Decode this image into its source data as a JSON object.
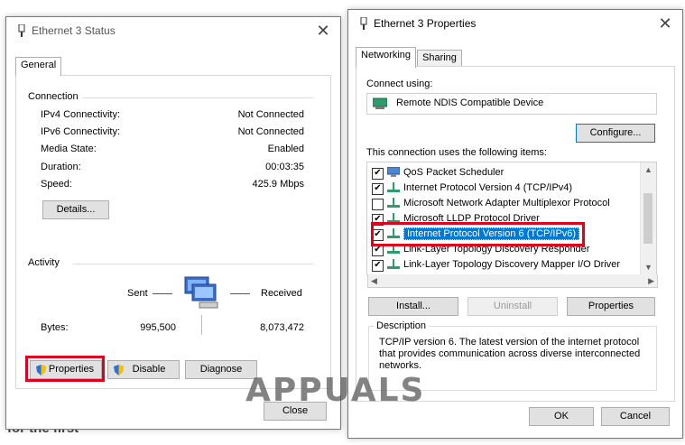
{
  "left_window": {
    "title": "Ethernet 3 Status",
    "tab": "General",
    "connection": {
      "heading": "Connection",
      "rows": [
        {
          "label": "IPv4 Connectivity:",
          "value": "Not Connected"
        },
        {
          "label": "IPv6 Connectivity:",
          "value": "Not Connected"
        },
        {
          "label": "Media State:",
          "value": "Enabled"
        },
        {
          "label": "Duration:",
          "value": "00:03:35"
        },
        {
          "label": "Speed:",
          "value": "425.9 Mbps"
        }
      ],
      "details_button": "Details..."
    },
    "activity": {
      "heading": "Activity",
      "sent_label": "Sent",
      "received_label": "Received",
      "bytes_label": "Bytes:",
      "bytes_sent": "995,500",
      "bytes_received": "8,073,472"
    },
    "buttons": {
      "properties": "Properties",
      "disable": "Disable",
      "diagnose": "Diagnose",
      "close": "Close"
    }
  },
  "right_window": {
    "title": "Ethernet 3 Properties",
    "tabs": [
      "Networking",
      "Sharing"
    ],
    "connect_using_label": "Connect using:",
    "adapter": "Remote NDIS Compatible Device",
    "configure_button": "Configure...",
    "items_label": "This connection uses the following items:",
    "items": [
      {
        "label": "QoS Packet Scheduler",
        "checked": true
      },
      {
        "label": "Internet Protocol Version 4 (TCP/IPv4)",
        "checked": true
      },
      {
        "label": "Microsoft Network Adapter Multiplexor Protocol",
        "checked": false
      },
      {
        "label": "Microsoft LLDP Protocol Driver",
        "checked": true
      },
      {
        "label": "Internet Protocol Version 6 (TCP/IPv6)",
        "checked": true
      },
      {
        "label": "Link-Layer Topology Discovery Responder",
        "checked": true
      },
      {
        "label": "Link-Layer Topology Discovery Mapper I/O Driver",
        "checked": true
      }
    ],
    "install_button": "Install...",
    "uninstall_button": "Uninstall",
    "properties_button": "Properties",
    "description_heading": "Description",
    "description_text": "TCP/IP version 6. The latest version of the internet protocol that provides communication across diverse interconnected networks.",
    "ok_button": "OK",
    "cancel_button": "Cancel"
  },
  "watermark": "APPUALS",
  "background_text": "for the first",
  "colors": {
    "highlight": "#0078d7",
    "annotation_red": "#e0001b"
  }
}
